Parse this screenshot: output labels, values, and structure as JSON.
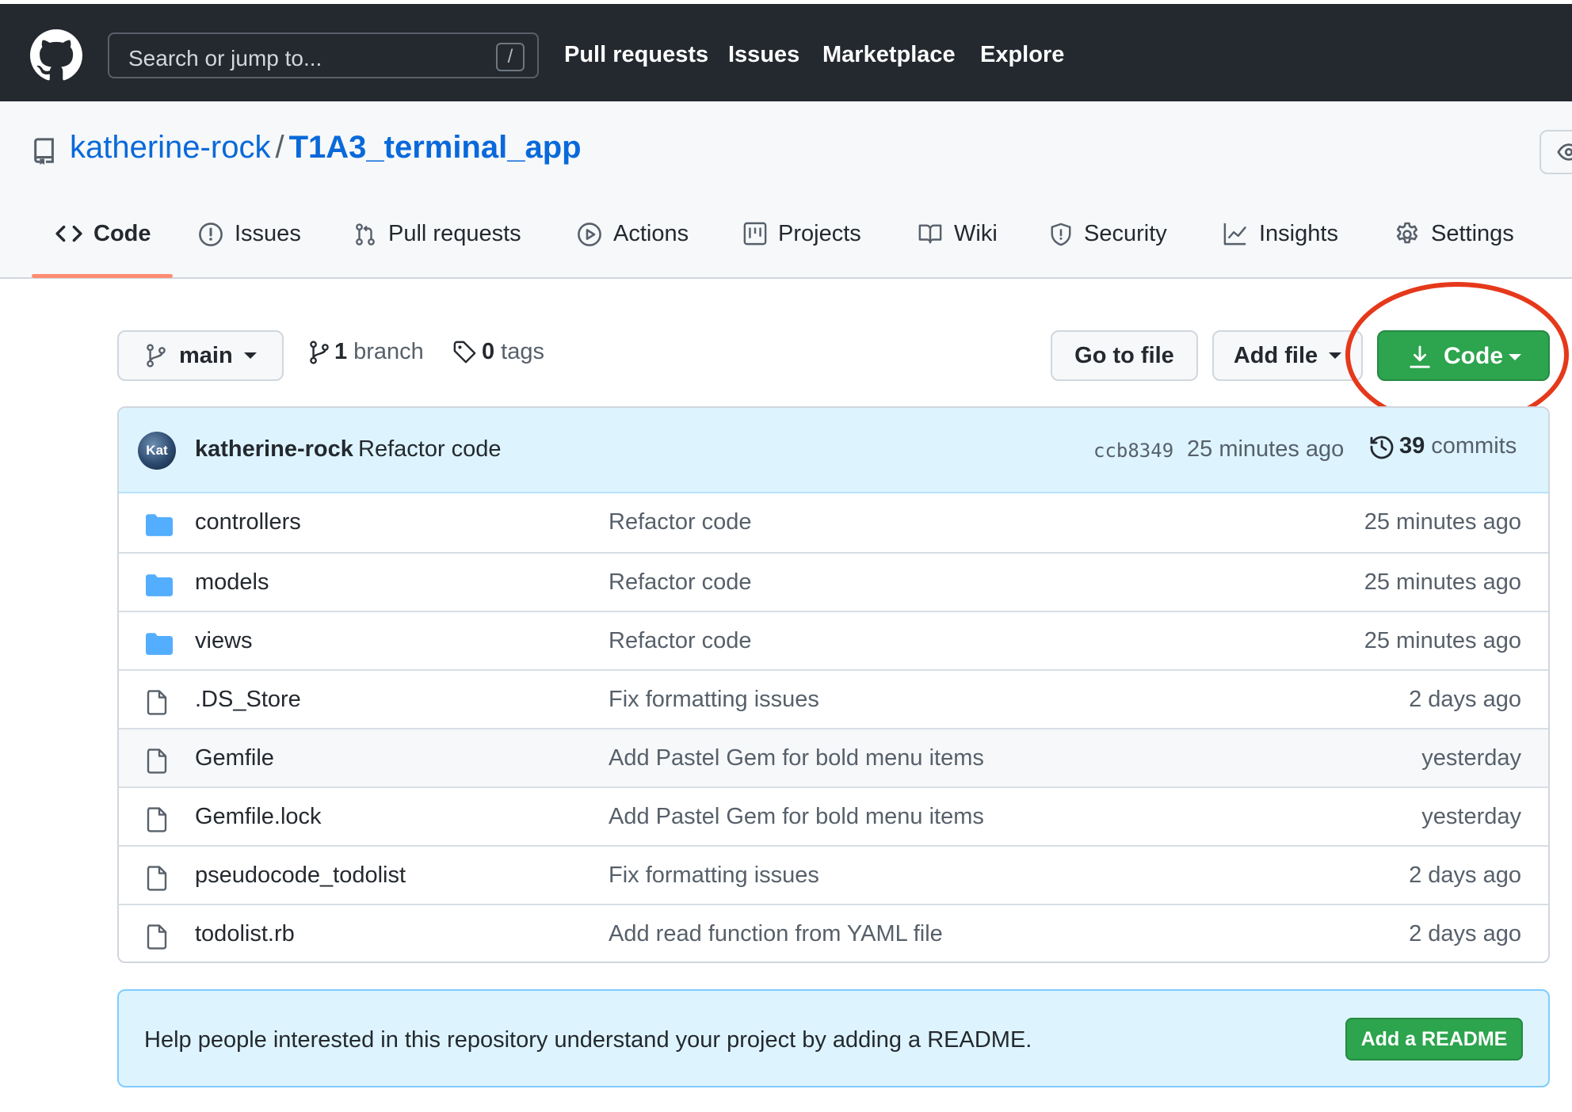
{
  "topnav": {
    "search_placeholder": "Search or jump to...",
    "search_shortcut": "/",
    "links": [
      "Pull requests",
      "Issues",
      "Marketplace",
      "Explore"
    ]
  },
  "repo": {
    "owner": "katherine-rock",
    "separator": "/",
    "name": "T1A3_terminal_app"
  },
  "tabs": {
    "code": "Code",
    "issues": "Issues",
    "pull_requests": "Pull requests",
    "actions": "Actions",
    "projects": "Projects",
    "wiki": "Wiki",
    "security": "Security",
    "insights": "Insights",
    "settings": "Settings"
  },
  "file_nav": {
    "branch_selector": "main",
    "branch_count": "1",
    "branch_label": "branch",
    "tag_count": "0",
    "tag_label": "tags",
    "go_to_file": "Go to file",
    "add_file": "Add file",
    "code_button": "Code"
  },
  "latest_commit": {
    "avatar_text": "Kat",
    "author": "katherine-rock",
    "message": "Refactor code",
    "sha": "ccb8349",
    "time": "25 minutes ago",
    "commit_count": "39",
    "commit_label": "commits"
  },
  "files": [
    {
      "name": "controllers",
      "type": "dir",
      "commit": "Refactor code",
      "age": "25 minutes ago"
    },
    {
      "name": "models",
      "type": "dir",
      "commit": "Refactor code",
      "age": "25 minutes ago"
    },
    {
      "name": "views",
      "type": "dir",
      "commit": "Refactor code",
      "age": "25 minutes ago"
    },
    {
      "name": ".DS_Store",
      "type": "file",
      "commit": "Fix formatting issues",
      "age": "2 days ago"
    },
    {
      "name": "Gemfile",
      "type": "file",
      "commit": "Add Pastel Gem for bold menu items",
      "age": "yesterday"
    },
    {
      "name": "Gemfile.lock",
      "type": "file",
      "commit": "Add Pastel Gem for bold menu items",
      "age": "yesterday"
    },
    {
      "name": "pseudocode_todolist",
      "type": "file",
      "commit": "Fix formatting issues",
      "age": "2 days ago"
    },
    {
      "name": "todolist.rb",
      "type": "file",
      "commit": "Add read function from YAML file",
      "age": "2 days ago"
    }
  ],
  "readme_banner": {
    "text": "Help people interested in this repository understand your project by adding a README.",
    "button": "Add a README"
  },
  "colors": {
    "header_bg": "#24292f",
    "link_blue": "#0969da",
    "primary_green": "#2da44e",
    "annotation_red": "#e5391b",
    "commit_row_bg": "#ddf4ff",
    "folder_blue": "#54aeff"
  },
  "icons": [
    "github-logo-icon",
    "repo-icon",
    "code-icon",
    "issue-icon",
    "pull-request-icon",
    "play-icon",
    "project-icon",
    "book-icon",
    "shield-icon",
    "graph-icon",
    "gear-icon",
    "git-branch-icon",
    "tag-icon",
    "download-icon",
    "history-icon",
    "folder-icon",
    "file-icon",
    "eye-icon"
  ]
}
